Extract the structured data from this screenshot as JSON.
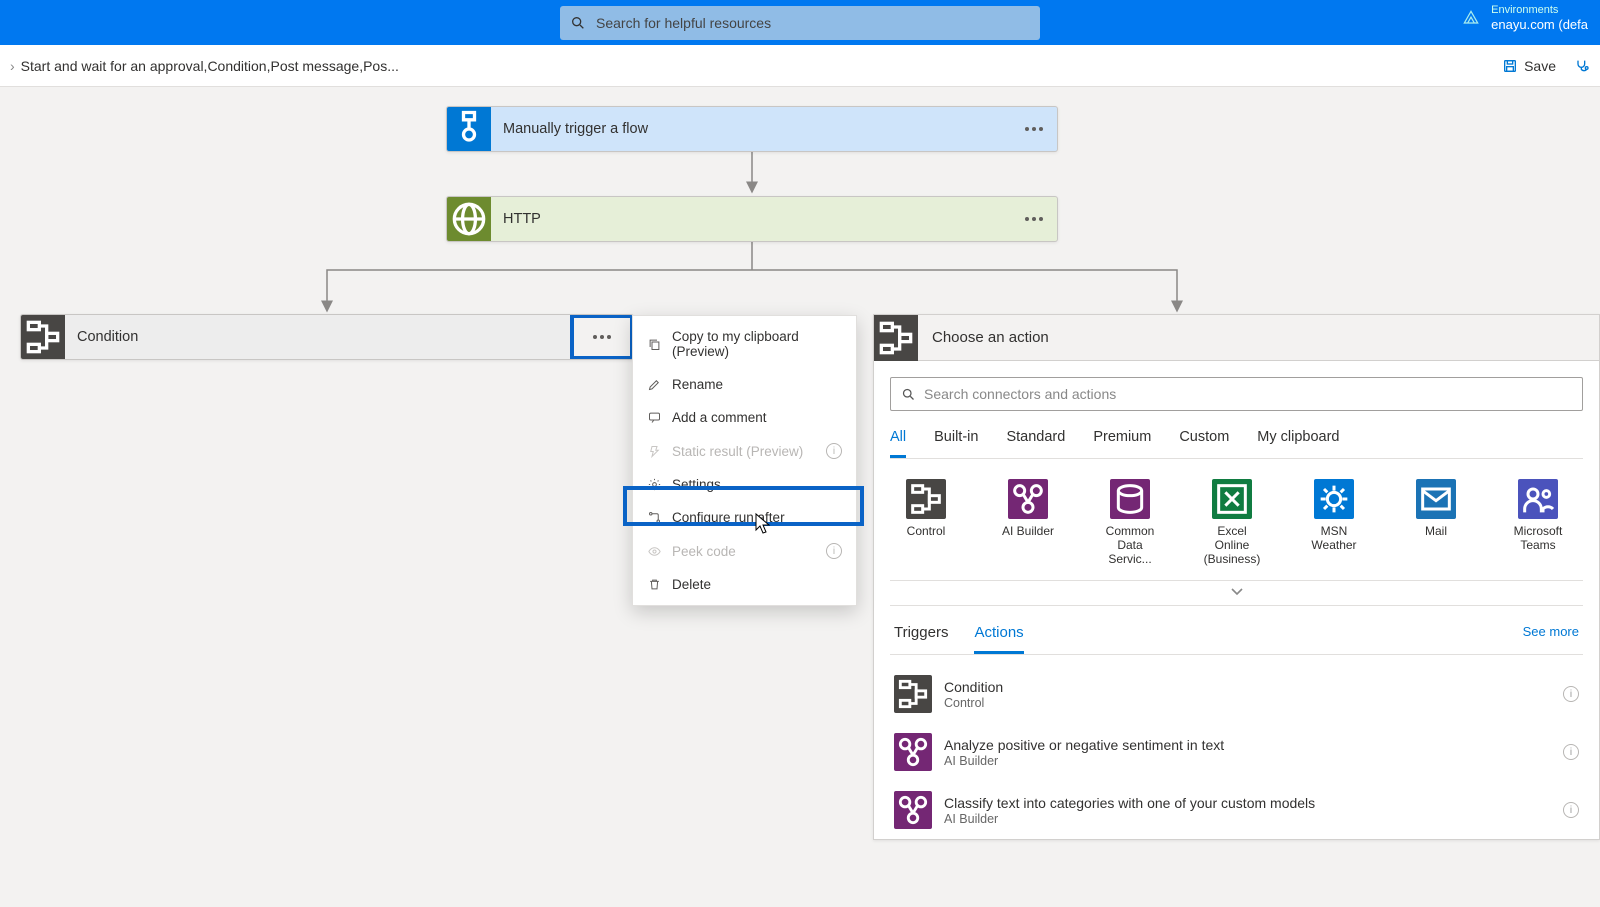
{
  "header": {
    "search_placeholder": "Search for helpful resources",
    "env_label": "Environments",
    "env_value": "enayu.com (defa"
  },
  "toolbar": {
    "breadcrumb": "Start and wait for an approval,Condition,Post message,Pos...",
    "save_label": "Save"
  },
  "flow": {
    "trigger_label": "Manually trigger a flow",
    "http_label": "HTTP",
    "condition_label": "Condition"
  },
  "context_menu": {
    "copy": "Copy to my clipboard (Preview)",
    "rename": "Rename",
    "add_comment": "Add a comment",
    "static_result": "Static result (Preview)",
    "settings": "Settings",
    "configure_run": "Configure run after",
    "peek_code": "Peek code",
    "delete": "Delete"
  },
  "action_panel": {
    "title": "Choose an action",
    "search_placeholder": "Search connectors and actions",
    "tabs": [
      "All",
      "Built-in",
      "Standard",
      "Premium",
      "Custom",
      "My clipboard"
    ],
    "connectors": [
      {
        "name": "Control",
        "color": "t-control"
      },
      {
        "name": "AI Builder",
        "color": "t-ai"
      },
      {
        "name": "Common Data Servic...",
        "color": "t-cds"
      },
      {
        "name": "Excel Online (Business)",
        "color": "t-excel"
      },
      {
        "name": "MSN Weather",
        "color": "t-msn"
      },
      {
        "name": "Mail",
        "color": "t-mail"
      },
      {
        "name": "Microsoft Teams",
        "color": "t-teams"
      }
    ],
    "subtabs": {
      "triggers": "Triggers",
      "actions": "Actions",
      "see_more": "See more"
    },
    "actions": [
      {
        "name": "Condition",
        "cat": "Control",
        "color": "t-control"
      },
      {
        "name": "Analyze positive or negative sentiment in text",
        "cat": "AI Builder",
        "color": "t-ai"
      },
      {
        "name": "Classify text into categories with one of your custom models",
        "cat": "AI Builder",
        "color": "t-ai"
      }
    ]
  }
}
